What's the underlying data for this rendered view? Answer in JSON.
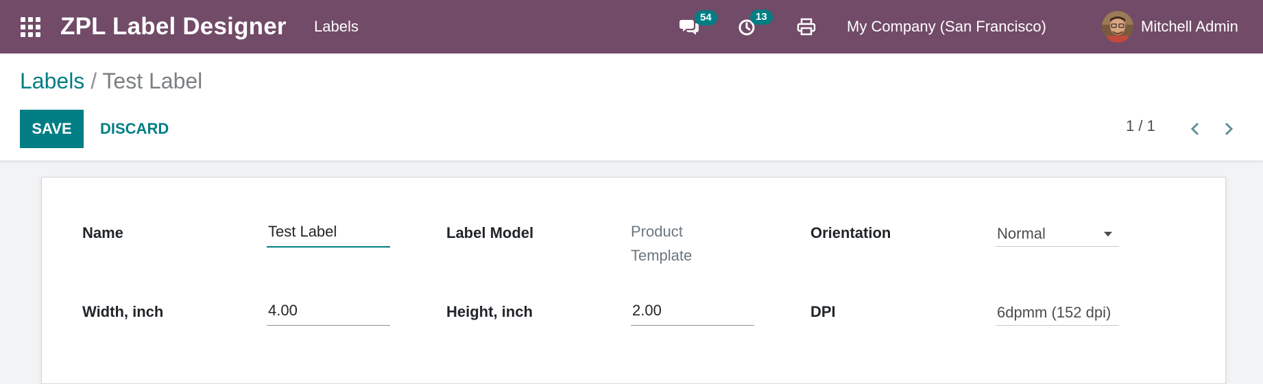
{
  "navbar": {
    "app_title": "ZPL Label Designer",
    "menu": {
      "labels": "Labels"
    },
    "messages_badge": "54",
    "activities_badge": "13",
    "company": "My Company (San Francisco)",
    "user": "Mitchell Admin",
    "accent_color": "#714b67",
    "badge_color": "#017e84"
  },
  "breadcrumb": {
    "parent": "Labels",
    "separator": "/",
    "current": "Test Label"
  },
  "buttons": {
    "save": "SAVE",
    "discard": "DISCARD"
  },
  "pager": {
    "value": "1 / 1"
  },
  "form": {
    "name": {
      "label": "Name",
      "value": "Test Label"
    },
    "label_model": {
      "label": "Label Model",
      "line1": "Product",
      "line2": "Template"
    },
    "orientation": {
      "label": "Orientation",
      "value": "Normal"
    },
    "width": {
      "label": "Width, inch",
      "value": "4.00"
    },
    "height": {
      "label": "Height, inch",
      "value": "2.00"
    },
    "dpi": {
      "label": "DPI",
      "value": "6dpmm (152 dpi)"
    }
  },
  "icons": [
    "apps-grid-icon",
    "chat-icon",
    "clock-icon",
    "printer-icon",
    "avatar",
    "chevron-left-icon",
    "chevron-right-icon",
    "chevron-down-icon"
  ]
}
